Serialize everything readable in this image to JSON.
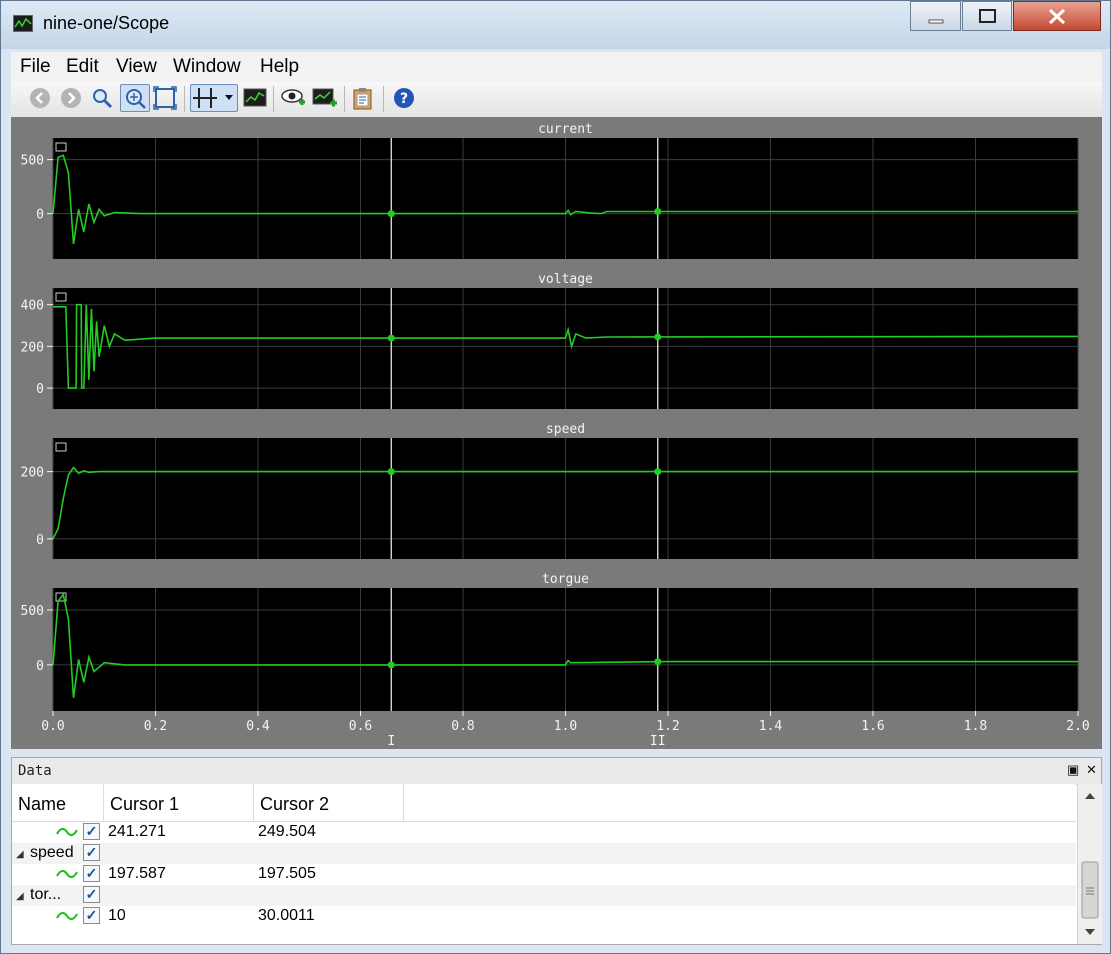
{
  "window": {
    "title": "nine-one/Scope"
  },
  "menu": [
    "File",
    "Edit",
    "View",
    "Window",
    "Help"
  ],
  "toolbar": {
    "buttons": [
      "back-icon",
      "forward-icon",
      "zoom-icon",
      "zoom-fit-icon",
      "zoom-box-icon",
      "cursor-tool-icon",
      "dropdown-icon",
      "scope-view-icon",
      "eye-add-icon",
      "plot-add-icon",
      "clipboard-icon",
      "help-icon"
    ]
  },
  "chart_data": [
    {
      "type": "line",
      "title": "current",
      "xlim": [
        0,
        2.0
      ],
      "yticks": [
        500,
        0
      ],
      "ylim": [
        -420,
        700
      ],
      "series": [
        {
          "values": [
            [
              0,
              0
            ],
            [
              0.01,
              520
            ],
            [
              0.02,
              540
            ],
            [
              0.03,
              380
            ],
            [
              0.04,
              -280
            ],
            [
              0.05,
              40
            ],
            [
              0.06,
              -170
            ],
            [
              0.07,
              90
            ],
            [
              0.08,
              -80
            ],
            [
              0.09,
              40
            ],
            [
              0.1,
              -20
            ],
            [
              0.12,
              10
            ],
            [
              0.17,
              0
            ],
            [
              1.0,
              0
            ],
            [
              1.005,
              30
            ],
            [
              1.01,
              -10
            ],
            [
              1.02,
              20
            ],
            [
              1.05,
              5
            ],
            [
              1.07,
              0
            ],
            [
              1.08,
              20
            ],
            [
              2.0,
              20
            ]
          ]
        }
      ]
    },
    {
      "type": "line",
      "title": "voltage",
      "xlim": [
        0,
        2.0
      ],
      "yticks": [
        400,
        200,
        0
      ],
      "ylim": [
        -100,
        480
      ],
      "series": [
        {
          "values": [
            [
              0,
              390
            ],
            [
              0.025,
              390
            ],
            [
              0.03,
              0
            ],
            [
              0.045,
              0
            ],
            [
              0.046,
              400
            ],
            [
              0.055,
              400
            ],
            [
              0.056,
              0
            ],
            [
              0.06,
              0
            ],
            [
              0.065,
              400
            ],
            [
              0.07,
              40
            ],
            [
              0.075,
              380
            ],
            [
              0.08,
              80
            ],
            [
              0.085,
              320
            ],
            [
              0.09,
              150
            ],
            [
              0.1,
              300
            ],
            [
              0.11,
              200
            ],
            [
              0.12,
              260
            ],
            [
              0.14,
              230
            ],
            [
              0.2,
              240
            ],
            [
              0.66,
              240
            ],
            [
              1.0,
              240
            ],
            [
              1.005,
              280
            ],
            [
              1.012,
              200
            ],
            [
              1.02,
              260
            ],
            [
              1.04,
              240
            ],
            [
              1.08,
              245
            ],
            [
              2.0,
              248
            ]
          ]
        }
      ]
    },
    {
      "type": "line",
      "title": "speed",
      "xlim": [
        0,
        2.0
      ],
      "yticks": [
        200,
        0
      ],
      "ylim": [
        -60,
        300
      ],
      "series": [
        {
          "values": [
            [
              0,
              0
            ],
            [
              0.01,
              30
            ],
            [
              0.02,
              120
            ],
            [
              0.03,
              190
            ],
            [
              0.04,
              212
            ],
            [
              0.05,
              195
            ],
            [
              0.06,
              202
            ],
            [
              0.07,
              198
            ],
            [
              0.09,
              200
            ],
            [
              2.0,
              200
            ]
          ]
        }
      ]
    },
    {
      "type": "line",
      "title": "torgue",
      "xlim": [
        0,
        2.0
      ],
      "yticks": [
        500,
        0
      ],
      "ylim": [
        -420,
        700
      ],
      "series": [
        {
          "values": [
            [
              0,
              0
            ],
            [
              0.01,
              580
            ],
            [
              0.02,
              640
            ],
            [
              0.03,
              420
            ],
            [
              0.04,
              -300
            ],
            [
              0.05,
              50
            ],
            [
              0.06,
              -160
            ],
            [
              0.07,
              70
            ],
            [
              0.08,
              -60
            ],
            [
              0.1,
              20
            ],
            [
              0.14,
              0
            ],
            [
              1.0,
              0
            ],
            [
              1.005,
              40
            ],
            [
              1.01,
              20
            ],
            [
              1.2,
              30
            ],
            [
              2.0,
              30
            ]
          ]
        }
      ]
    }
  ],
  "xaxis": {
    "ticks": [
      "0.0",
      "0.2",
      "0.4",
      "0.6",
      "0.8",
      "1.0",
      "1.2",
      "1.4",
      "1.6",
      "1.8",
      "2.0"
    ]
  },
  "cursors": [
    {
      "x": 0.66,
      "label": "I"
    },
    {
      "x": 1.18,
      "label": "II"
    }
  ],
  "data_panel": {
    "title": "Data",
    "columns": [
      "Name",
      "Cursor 1",
      "Cursor 2"
    ],
    "rows": [
      {
        "kind": "signal",
        "cursor1": "241.271",
        "cursor2": "249.504"
      },
      {
        "kind": "group",
        "name": "speed"
      },
      {
        "kind": "signal",
        "cursor1": "197.587",
        "cursor2": "197.505"
      },
      {
        "kind": "group",
        "name": "tor..."
      },
      {
        "kind": "signal",
        "cursor1": "10",
        "cursor2": "30.0011"
      }
    ]
  },
  "colors": {
    "trace": "#22cc22",
    "plot_bg": "#000000",
    "frame_bg": "#7a7a7a",
    "grid": "#3c3c3c",
    "cursor": "#e8e8e8"
  }
}
